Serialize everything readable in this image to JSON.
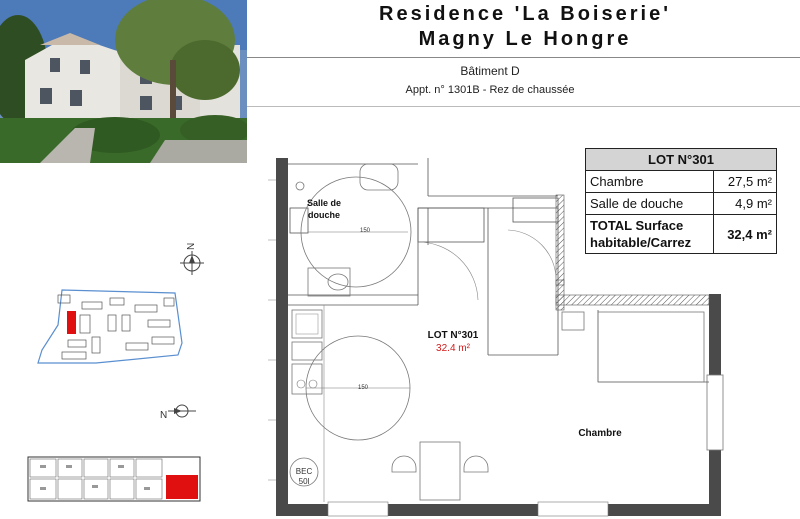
{
  "header": {
    "title_line1": "Residence 'La Boiserie'",
    "title_line2": "Magny Le Hongre",
    "building": "Bâtiment D",
    "apartment": "Appt. n° 1301B - Rez de chaussée"
  },
  "lot_table": {
    "title": "LOT N°301",
    "rows": [
      {
        "label": "Chambre",
        "value": "27,5 m²"
      },
      {
        "label": "Salle de douche",
        "value": "4,9 m²"
      }
    ],
    "total_label_1": "TOTAL Surface",
    "total_label_2": "habitable/Carrez",
    "total_value": "32,4 m²"
  },
  "plan": {
    "salle_label_1": "Salle de",
    "salle_label_2": "douche",
    "lot_label": "LOT N°301",
    "lot_area": "32.4 m²",
    "chambre_label": "Chambre",
    "bec_label_1": "BEC",
    "bec_label_2": "50l",
    "dim_1": "150",
    "dim_2": "150",
    "north_1": "N",
    "north_2": "N"
  },
  "colors": {
    "highlight": "#e01010",
    "site_outline": "#5a8fd0",
    "wall": "#4a4a4a"
  }
}
